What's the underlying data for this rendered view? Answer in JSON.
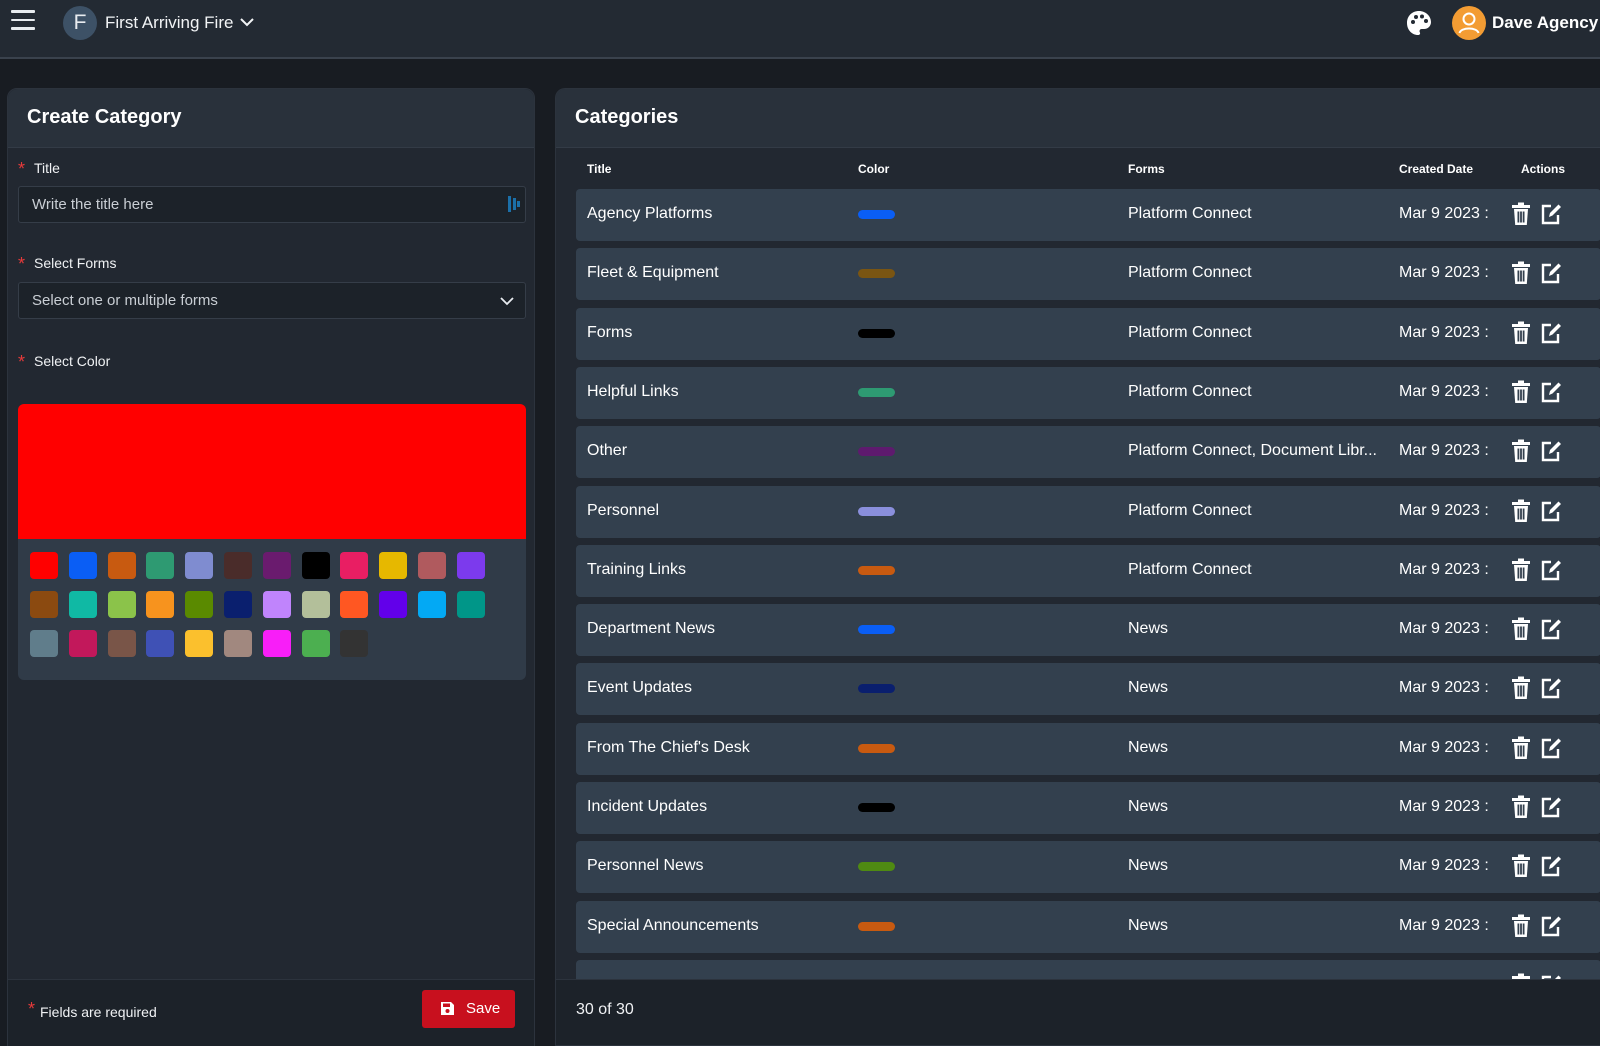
{
  "header": {
    "org_initial": "F",
    "org_name": "First Arriving Fire",
    "user_name": "Dave Agency"
  },
  "create_category": {
    "title": "Create Category",
    "title_label": "Title",
    "title_placeholder": "Write the title here",
    "forms_label": "Select Forms",
    "forms_placeholder": "Select one or multiple forms",
    "color_label": "Select Color",
    "selected_color": "#ff0000",
    "swatches": [
      "#ff0000",
      "#0a5ef5",
      "#c85a10",
      "#2e9a72",
      "#7f8cd0",
      "#4a2c2a",
      "#6a1b6e",
      "#000000",
      "#e91e63",
      "#e6b800",
      "#b05a5e",
      "#7c3aed",
      "#8b4a10",
      "#10b9a4",
      "#8bc34a",
      "#f7931e",
      "#5a8a00",
      "#0a1f6e",
      "#c084fc",
      "#b3bf9a",
      "#ff5722",
      "#6200ea",
      "#03a9f4",
      "#009688",
      "#607d8b",
      "#c2185b",
      "#795548",
      "#3f51b5",
      "#fbc02d",
      "#a1887f",
      "#f81ef8",
      "#4caf50",
      "#333333"
    ],
    "required_note": "Fields are required",
    "save_label": "Save"
  },
  "categories": {
    "title": "Categories",
    "columns": [
      "Title",
      "Color",
      "Forms",
      "Created Date",
      "Actions"
    ],
    "rows": [
      {
        "title": "Agency Platforms",
        "color": "#0a5ef5",
        "forms": "Platform Connect",
        "date": "Mar 9 2023 :"
      },
      {
        "title": "Fleet & Equipment",
        "color": "#7a5512",
        "forms": "Platform Connect",
        "date": "Mar 9 2023 :"
      },
      {
        "title": "Forms",
        "color": "#000000",
        "forms": "Platform Connect",
        "date": "Mar 9 2023 :"
      },
      {
        "title": "Helpful Links",
        "color": "#2e9a72",
        "forms": "Platform Connect",
        "date": "Mar 9 2023 :"
      },
      {
        "title": "Other",
        "color": "#5e1a6e",
        "forms": "Platform Connect, Document Libr...",
        "date": "Mar 9 2023 :"
      },
      {
        "title": "Personnel",
        "color": "#8a8fdc",
        "forms": "Platform Connect",
        "date": "Mar 9 2023 :"
      },
      {
        "title": "Training Links",
        "color": "#c85a10",
        "forms": "Platform Connect",
        "date": "Mar 9 2023 :"
      },
      {
        "title": "Department News",
        "color": "#0a5ef5",
        "forms": "News",
        "date": "Mar 9 2023 :"
      },
      {
        "title": "Event Updates",
        "color": "#0a1f6e",
        "forms": "News",
        "date": "Mar 9 2023 :"
      },
      {
        "title": "From The Chief's Desk",
        "color": "#c85a10",
        "forms": "News",
        "date": "Mar 9 2023 :"
      },
      {
        "title": "Incident Updates",
        "color": "#000000",
        "forms": "News",
        "date": "Mar 9 2023 :"
      },
      {
        "title": "Personnel News",
        "color": "#4f8a12",
        "forms": "News",
        "date": "Mar 9 2023 :"
      },
      {
        "title": "Special Announcements",
        "color": "#c85a10",
        "forms": "News",
        "date": "Mar 9 2023 :"
      },
      {
        "title": "",
        "color": "#2e9a72",
        "forms": "",
        "date": ""
      }
    ],
    "count_text": "30 of 30"
  }
}
